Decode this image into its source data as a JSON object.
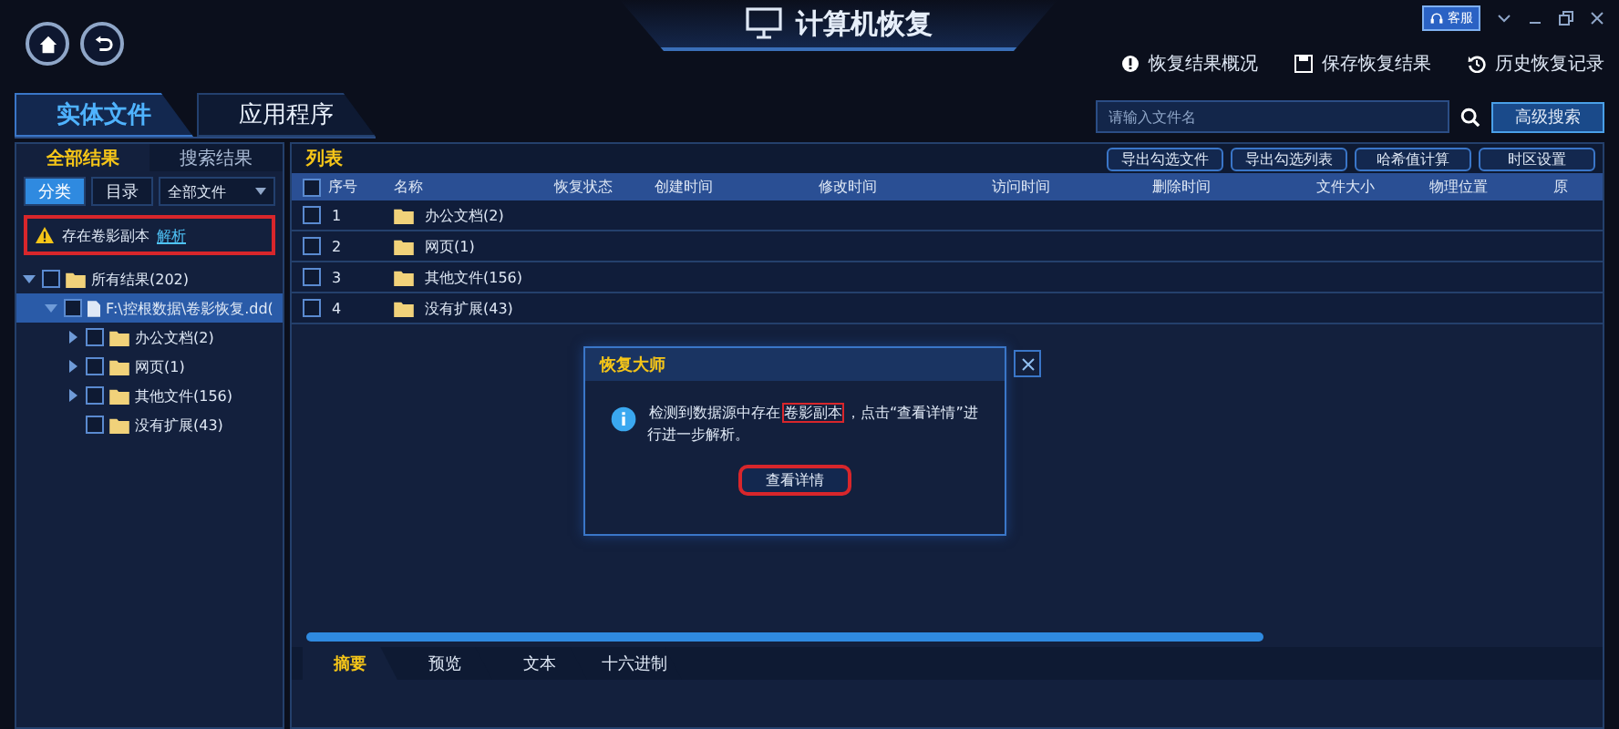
{
  "window": {
    "title": "计算机恢复",
    "support_badge": "客服"
  },
  "header_links": [
    {
      "label": "恢复结果概况",
      "kind": "info"
    },
    {
      "label": "保存恢复结果",
      "kind": "save"
    },
    {
      "label": "历史恢复记录",
      "kind": "history"
    }
  ],
  "main_tabs": [
    {
      "label": "实体文件",
      "selected": true
    },
    {
      "label": "应用程序",
      "selected": false
    }
  ],
  "search": {
    "placeholder": "请输入文件名",
    "advanced_button": "高级搜索"
  },
  "left_panel": {
    "tabs": [
      {
        "label": "全部结果",
        "selected": true
      },
      {
        "label": "搜索结果",
        "selected": false
      }
    ],
    "view_buttons": [
      {
        "label": "分类",
        "selected": true
      },
      {
        "label": "目录",
        "selected": false
      }
    ],
    "filter": {
      "value": "全部文件"
    },
    "warning": {
      "text": "存在卷影副本",
      "link": "解析",
      "highlighted": true
    },
    "tree": [
      {
        "label": "所有结果(202)",
        "kind": "folder",
        "checked": false,
        "expanded": true,
        "selected": false,
        "children": [
          {
            "label": "F:\\控根数据\\卷影恢复.dd(",
            "kind": "disk",
            "checked": false,
            "expanded": true,
            "selected": true,
            "children": [
              {
                "label": "办公文档(2)",
                "kind": "folder",
                "checked": false,
                "expanded": false,
                "selected": false
              },
              {
                "label": "网页(1)",
                "kind": "folder",
                "checked": false,
                "expanded": false,
                "selected": false
              },
              {
                "label": "其他文件(156)",
                "kind": "folder",
                "checked": false,
                "expanded": false,
                "selected": false
              },
              {
                "label": "没有扩展(43)",
                "kind": "folder",
                "checked": false,
                "selected": false
              }
            ]
          }
        ]
      }
    ]
  },
  "list": {
    "title": "列表",
    "actions": [
      "导出勾选文件",
      "导出勾选列表",
      "哈希值计算",
      "时区设置"
    ],
    "columns": [
      "序号",
      "名称",
      "恢复状态",
      "创建时间",
      "修改时间",
      "访问时间",
      "删除时间",
      "文件大小",
      "物理位置",
      "原"
    ],
    "header_checked": false,
    "rows": [
      {
        "index": "1",
        "name": "办公文档(2)",
        "checked": false
      },
      {
        "index": "2",
        "name": "网页(1)",
        "checked": false
      },
      {
        "index": "3",
        "name": "其他文件(156)",
        "checked": false
      },
      {
        "index": "4",
        "name": "没有扩展(43)",
        "checked": false
      }
    ]
  },
  "detail_tabs": [
    {
      "label": "摘要",
      "selected": true
    },
    {
      "label": "预览",
      "selected": false
    },
    {
      "label": "文本",
      "selected": false
    },
    {
      "label": "十六进制",
      "selected": false
    }
  ],
  "dialog": {
    "title": "恢复大师",
    "message_parts": [
      {
        "text": "检测到数据源中存在",
        "highlighted": false
      },
      {
        "text": "卷影副本",
        "highlighted": true
      },
      {
        "text": "，点击“查看详情”进行进一步解析。",
        "highlighted": false
      }
    ],
    "button": {
      "label": "查看详情",
      "highlighted": true
    }
  }
}
